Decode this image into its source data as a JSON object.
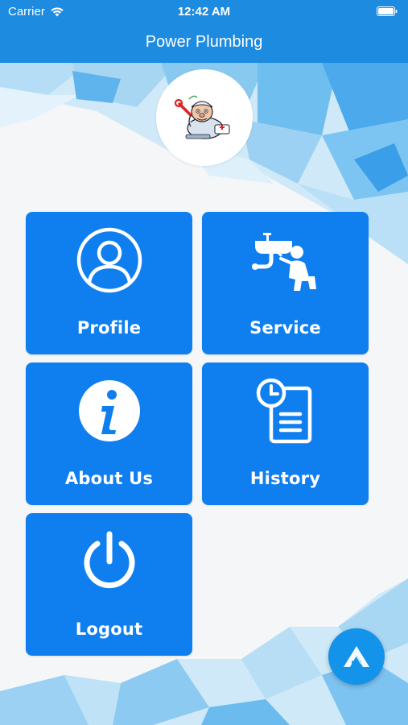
{
  "status_bar": {
    "carrier": "Carrier",
    "time": "12:42 AM"
  },
  "nav": {
    "title": "Power Plumbing"
  },
  "logo": {
    "icon": "plumber-mascot-icon"
  },
  "tiles": [
    {
      "label": "Profile",
      "icon": "user-circle-icon"
    },
    {
      "label": "Service",
      "icon": "plumber-repair-icon"
    },
    {
      "label": "About Us",
      "icon": "info-icon"
    },
    {
      "label": "History",
      "icon": "history-clipboard-icon"
    },
    {
      "label": "Logout",
      "icon": "power-icon"
    }
  ],
  "colors": {
    "nav": "#1c8be0",
    "tile": "#0f7ff0",
    "fab": "#1493ea"
  },
  "fab": {
    "icon": "app-logo-icon"
  }
}
